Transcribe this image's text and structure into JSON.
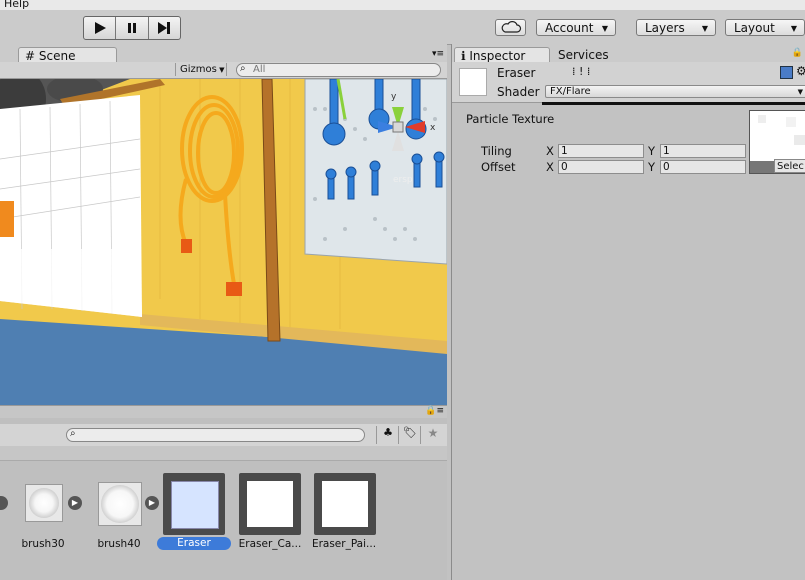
{
  "menubar": {
    "help": "Help"
  },
  "toolbar": {
    "play_icon": "play-icon",
    "pause_icon": "pause-icon",
    "step_icon": "step-icon",
    "account": "Account",
    "layers": "Layers",
    "layout": "Layout"
  },
  "scene": {
    "tab_label": "Scene",
    "gizmos": "Gizmos",
    "search_placeholder": "All",
    "gizmo_persp": "ersp",
    "gizmo_y": "y",
    "gizmo_x": "x"
  },
  "project": {
    "items": [
      {
        "name": "brush30",
        "selected": false
      },
      {
        "name": "brush40",
        "selected": false
      },
      {
        "name": "Eraser",
        "selected": true
      },
      {
        "name": "Eraser_Ca...",
        "selected": false
      },
      {
        "name": "Eraser_Pai...",
        "selected": false
      }
    ]
  },
  "inspector": {
    "tabs": [
      "Inspector",
      "Services"
    ],
    "object_name": "Eraser",
    "shader_label": "Shader",
    "shader_value": "FX/Flare",
    "property_label": "Particle Texture",
    "tiling_label": "Tiling",
    "offset_label": "Offset",
    "x_label": "X",
    "y_label": "Y",
    "tiling_x": "1",
    "tiling_y": "1",
    "offset_x": "0",
    "offset_y": "0",
    "select_label": "Selec"
  },
  "colors": {
    "selection_blue": "#3d7bd9",
    "wall_yellow": "#f0c94a",
    "floor_blue": "#4f7fb2"
  }
}
